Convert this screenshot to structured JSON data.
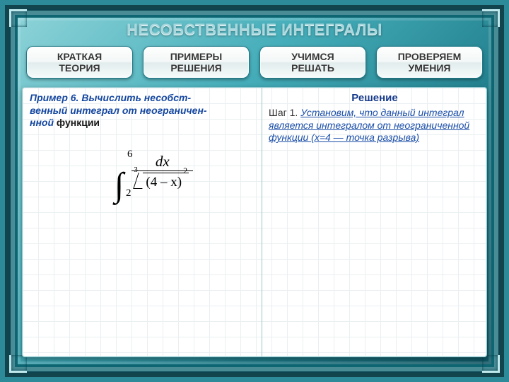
{
  "title": "НЕСОБСТВЕННЫЕ ИНТЕГРАЛЫ",
  "nav": {
    "theory": "КРАТКАЯ\nТЕОРИЯ",
    "examples": "ПРИМЕРЫ\nРЕШЕНИЯ",
    "learn": "УЧИМСЯ\nРЕШАТЬ",
    "check": "ПРОВЕРЯЕМ\nУМЕНИЯ"
  },
  "left": {
    "example_label": "Пример 6.",
    "task_line1": "Вычислить несобст-",
    "task_line2": "венный интеграл от неограничен-",
    "task_line3": "нной",
    "task_func_word": "функции",
    "formula": {
      "lower": "2",
      "upper": "6",
      "numerator": "dx",
      "root_index": "3",
      "radicand": "(4 – x)",
      "outer_power": "2"
    }
  },
  "right": {
    "solution_title": "Решение",
    "step_label": "Шаг 1.",
    "step_text_1": "Установим, что данный интеграл",
    "step_text_2": "является интегралом от неограниченной",
    "step_text_3": "функции (x=4 — точка разрыва)"
  },
  "chart_data": {
    "type": "table",
    "title": "Graph-paper background grid (no plotted data)",
    "categories": [],
    "values": []
  }
}
